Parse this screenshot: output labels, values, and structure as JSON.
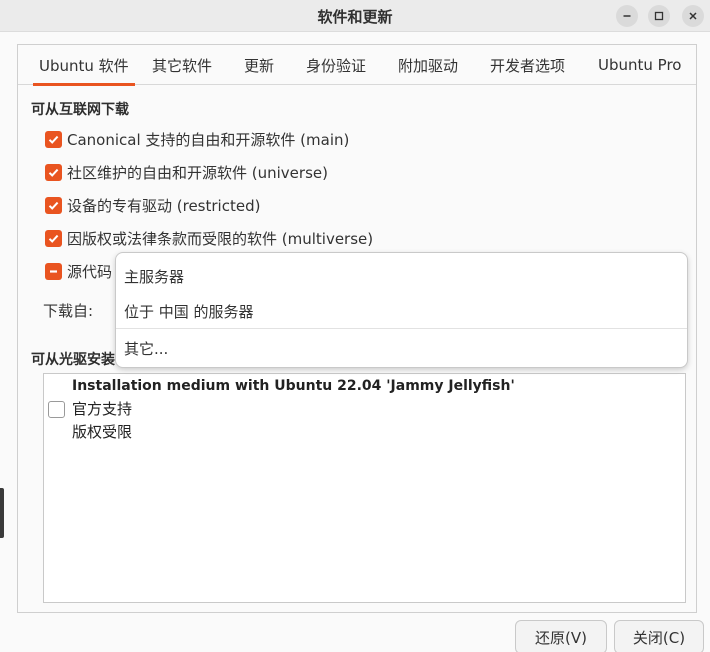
{
  "window": {
    "title": "软件和更新",
    "controls": {
      "minimize": "–",
      "maximize": "□",
      "close": "✕"
    }
  },
  "tabs": [
    {
      "label": "Ubuntu 软件",
      "active": true
    },
    {
      "label": "其它软件",
      "active": false
    },
    {
      "label": "更新",
      "active": false
    },
    {
      "label": "身份验证",
      "active": false
    },
    {
      "label": "附加驱动",
      "active": false
    },
    {
      "label": "开发者选项",
      "active": false
    },
    {
      "label": "Ubuntu Pro",
      "active": false
    }
  ],
  "internet_section": {
    "title": "可从互联网下载",
    "items": [
      {
        "label": "Canonical 支持的自由和开源软件 (main)",
        "state": "checked"
      },
      {
        "label": "社区维护的自由和开源软件 (universe)",
        "state": "checked"
      },
      {
        "label": "设备的专有驱动 (restricted)",
        "state": "checked"
      },
      {
        "label": "因版权或法律条款而受限的软件 (multiverse)",
        "state": "checked"
      },
      {
        "label": "源代码",
        "state": "mixed"
      }
    ],
    "download_from_label": "下载自:"
  },
  "server_popover": {
    "items": [
      "主服务器",
      "位于 中国 的服务器",
      "其它..."
    ]
  },
  "cdrom_section": {
    "title": "可从光驱安装",
    "media_title": "Installation medium with Ubuntu 22.04 'Jammy Jellyfish'",
    "media_lines": [
      "官方支持",
      "版权受限"
    ],
    "media_checked": false
  },
  "buttons": {
    "revert": "还原(V)",
    "close": "关闭(C)"
  },
  "colors": {
    "accent": "#e95420",
    "titlebar": "#ebebeb",
    "background": "#fafafa"
  }
}
